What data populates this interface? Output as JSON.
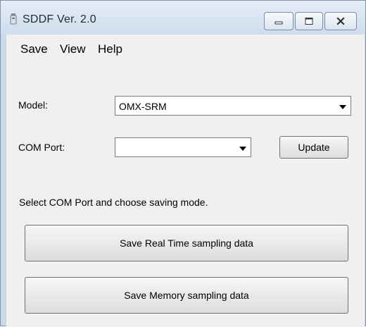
{
  "window": {
    "title": "SDDF Ver. 2.0",
    "icon": "app-icon",
    "controls": {
      "minimize": "minimize-icon",
      "maximize": "maximize-icon",
      "close": "close-icon"
    }
  },
  "menu": {
    "items": [
      {
        "label": "Save"
      },
      {
        "label": "View"
      },
      {
        "label": "Help"
      }
    ]
  },
  "form": {
    "model": {
      "label": "Model:",
      "value": "OMX-SRM"
    },
    "com_port": {
      "label": "COM Port:",
      "value": "",
      "update_label": "Update"
    }
  },
  "status_text": "Select COM Port and choose saving mode.",
  "actions": {
    "realtime_label": "Save Real Time sampling data",
    "memory_label": "Save Memory sampling data"
  },
  "colors": {
    "titlebar": "#cfdceb",
    "client": "#f0f0f0"
  }
}
